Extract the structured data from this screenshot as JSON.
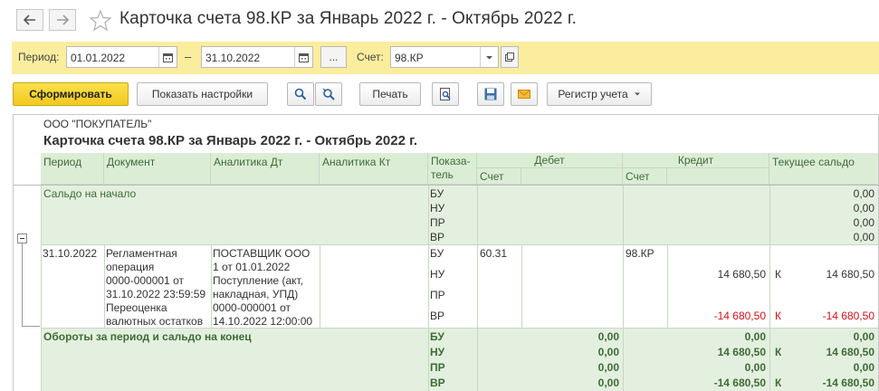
{
  "window": {
    "title": "Карточка счета 98.КР за Январь 2022 г. - Октябрь 2022 г."
  },
  "params": {
    "period_label": "Период:",
    "date_from": "01.01.2022",
    "dash": "–",
    "date_to": "31.10.2022",
    "dots": "...",
    "account_label": "Счет:",
    "account": "98.КР"
  },
  "toolbar": {
    "generate": "Сформировать",
    "show_settings": "Показать настройки",
    "print": "Печать",
    "register": "Регистр учета"
  },
  "report": {
    "organization": "ООО \"ПОКУПАТЕЛЬ\"",
    "title": "Карточка счета 98.КР за Январь 2022 г. - Октябрь 2022 г.",
    "headers": {
      "period": "Период",
      "document": "Документ",
      "analytics_dt": "Аналитика Дт",
      "analytics_kt": "Аналитика Кт",
      "indicator_1": "Показа-",
      "indicator_2": "тель",
      "debit": "Дебет",
      "credit": "Кредит",
      "balance": "Текущее сальдо",
      "debit_account": "Счет",
      "credit_account": "Счет"
    },
    "opening": {
      "label": "Сальдо на начало",
      "indicators": [
        "БУ",
        "НУ",
        "ПР",
        "ВР"
      ],
      "values": [
        "0,00",
        "0,00",
        "0,00",
        "0,00"
      ]
    },
    "row": {
      "period": "31.10.2022",
      "document_lines": [
        "Регламентная",
        "операция",
        "0000-000001 от",
        "31.10.2022 23:59:59",
        "Переоценка",
        "валютных остатков"
      ],
      "analytics_dt_lines": [
        "ПОСТАВЩИК ООО",
        "1 от 01.01.2022",
        "Поступление (акт,",
        "накладная, УПД)",
        "0000-000001 от",
        "14.10.2022 12:00:00"
      ],
      "indicators": [
        "БУ",
        "НУ",
        "ПР",
        "ВР"
      ],
      "debit_account": "60.31",
      "credit_account": "98.КР",
      "credit_nu": "14 680,50",
      "credit_vr": "-14 680,50",
      "balance_nu_side": "К",
      "balance_nu": "14 680,50",
      "balance_vr_side": "К",
      "balance_vr": "-14 680,50"
    },
    "totals": {
      "label": "Обороты за период и сальдо на конец",
      "indicators": [
        "БУ",
        "НУ",
        "ПР",
        "ВР"
      ],
      "debit": [
        "0,00",
        "0,00",
        "0,00",
        "0,00"
      ],
      "credit": [
        "0,00",
        "14 680,50",
        "0,00",
        "-14 680,50"
      ],
      "balance_side": [
        "",
        "К",
        "",
        "К"
      ],
      "balance": [
        "0,00",
        "14 680,50",
        "0,00",
        "-14 680,50"
      ]
    }
  }
}
